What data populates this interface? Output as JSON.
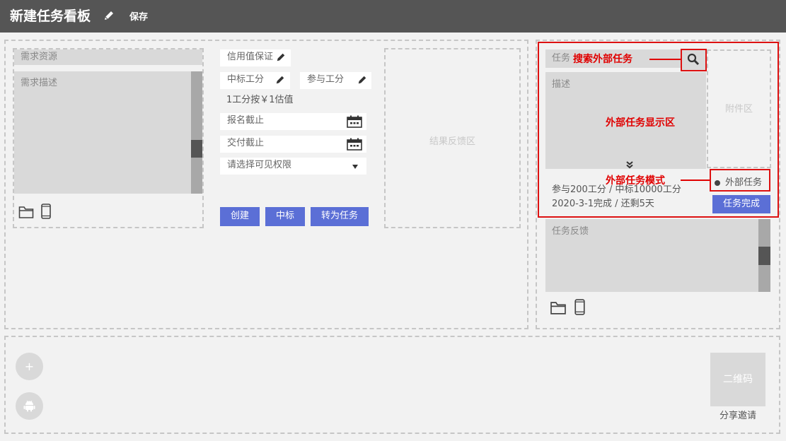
{
  "header": {
    "title": "新建任务看板",
    "save_label": "保存",
    "bg_color": "#555555"
  },
  "left_panel": {
    "resource_placeholder": "需求资源",
    "description_placeholder": "需求描述",
    "credit_guarantee": "信用值保证",
    "bid_points": "中标工分",
    "join_points": "参与工分",
    "rate_text": "1工分按￥1估值",
    "signup_deadline": "报名截止",
    "delivery_deadline": "交付截止",
    "visibility_placeholder": "请选择可见权限",
    "buttons": {
      "create": "创建",
      "bid": "中标",
      "convert": "转为任务"
    },
    "result_area": "结果反馈区"
  },
  "right_panel": {
    "task_placeholder": "任务",
    "description": "描述",
    "attachment_area": "附件区",
    "stats_line": "参与200工分 / 中标10000工分",
    "date_line": "2020-3-1完成 / 还剩5天",
    "external_task_label": "外部任务",
    "complete_button": "任务完成",
    "feedback_placeholder": "任务反馈"
  },
  "annotations": {
    "search_external": "搜索外部任务",
    "external_display": "外部任务显示区",
    "external_mode": "外部任务模式"
  },
  "bottom": {
    "add": "+",
    "qr_code": "二维码",
    "share_invite": "分享邀请"
  },
  "colors": {
    "accent": "#5b6fd6",
    "annotation": "#e00000",
    "panel_grey": "#d9d9d9"
  }
}
